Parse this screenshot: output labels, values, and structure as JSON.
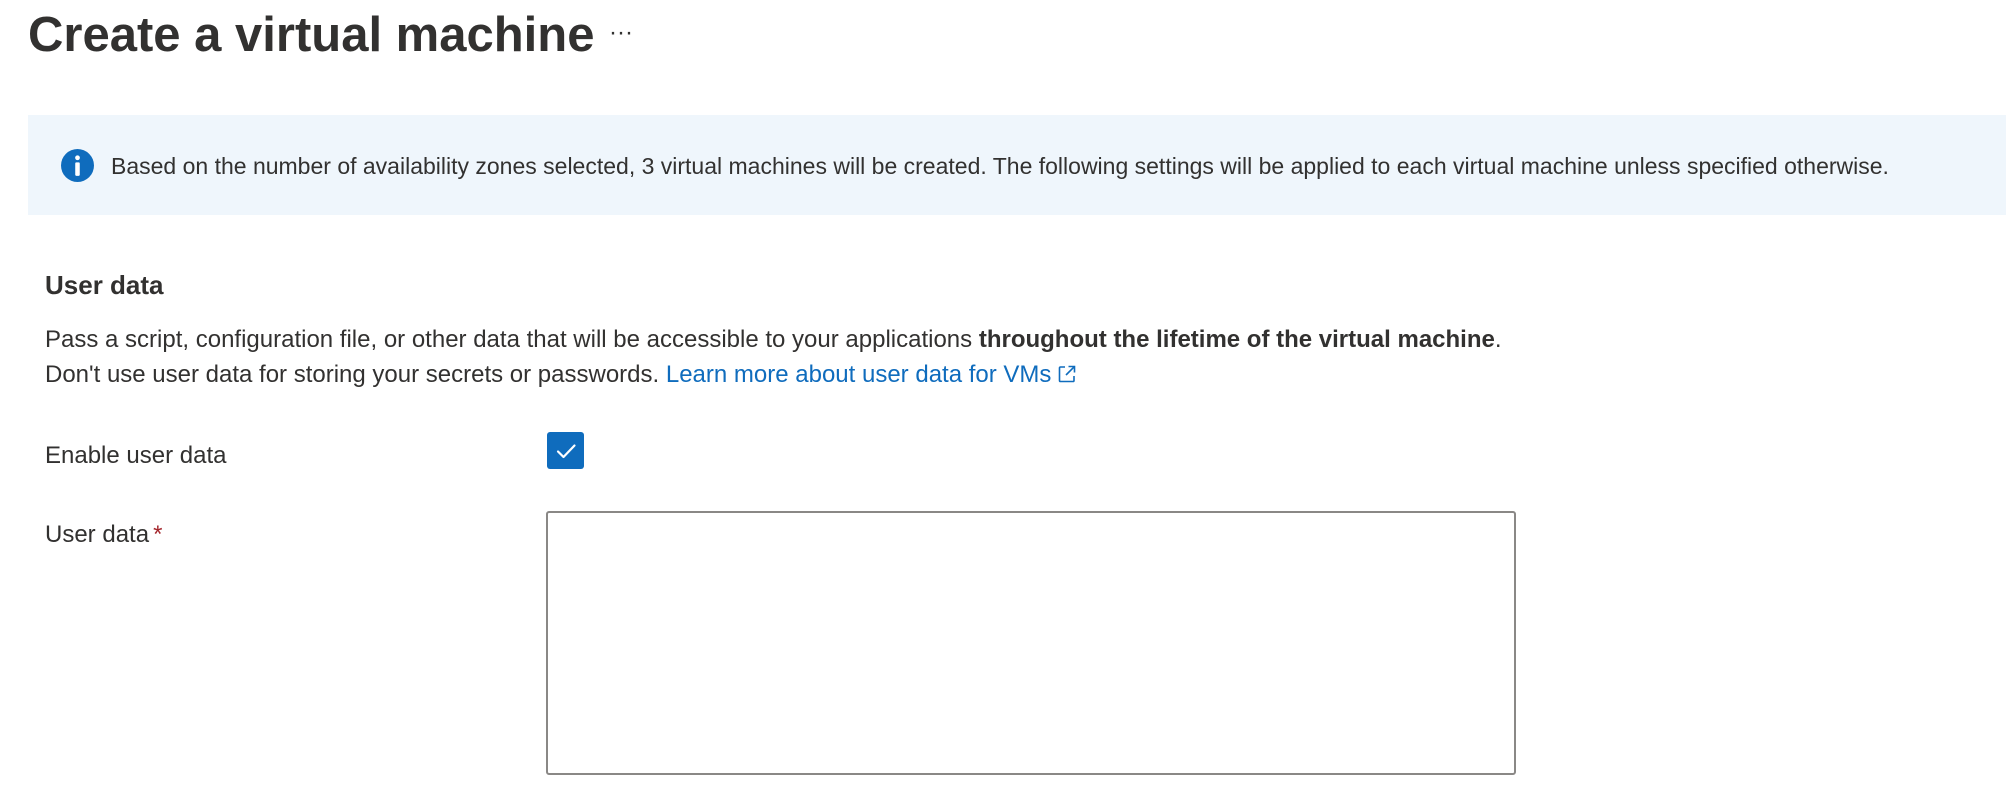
{
  "header": {
    "title": "Create a virtual machine",
    "more_label": "···"
  },
  "info_banner": {
    "icon": "info-icon",
    "text": "Based on the number of availability zones selected, 3 virtual machines will be created. The following settings will be applied to each virtual machine unless specified otherwise."
  },
  "user_data_section": {
    "heading": "User data",
    "description_part1": "Pass a script, configuration file, or other data that will be accessible to your applications ",
    "description_bold": "throughout the lifetime of the virtual machine",
    "description_part2": ". Don't use user data for storing your secrets or passwords. ",
    "learn_more_link": "Learn more about user data for VMs",
    "learn_more_icon": "external-link-icon",
    "enable_label": "Enable user data",
    "enable_checked": true,
    "user_data_label": "User data",
    "required_marker": "*",
    "user_data_value": ""
  },
  "colors": {
    "accent": "#0f6cbd",
    "banner_background": "#eff6fc",
    "required": "#a4262c",
    "text": "#323130"
  }
}
